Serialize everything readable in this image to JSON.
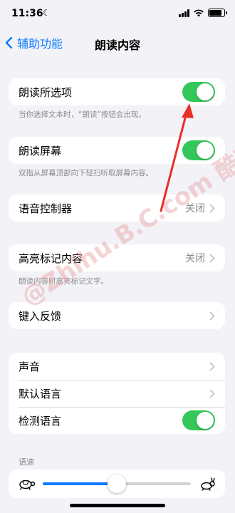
{
  "status": {
    "time": "11:36",
    "battery_level": 0.85
  },
  "nav": {
    "back_label": "辅助功能",
    "title": "朗读内容"
  },
  "groups": {
    "speak_selection": {
      "label": "朗读所选项",
      "toggle": true,
      "footnote": "当你选择文本时，“朗读”按钮会出现。"
    },
    "speak_screen": {
      "label": "朗读屏幕",
      "toggle": true,
      "footnote": "双指从屏幕顶部向下轻扫听取屏幕内容。"
    },
    "speech_controller": {
      "label": "语音控制器",
      "value": "关闭"
    },
    "highlight": {
      "label": "高亮标记内容",
      "value": "关闭",
      "footnote": "朗读内容时高亮标记文字。"
    },
    "typing_feedback": {
      "label": "键入反馈"
    },
    "voices": {
      "label": "声音"
    },
    "default_language": {
      "label": "默认语言"
    },
    "detect_language": {
      "label": "检测语言",
      "toggle": true
    }
  },
  "speaking_rate": {
    "header": "语速",
    "value": 0.5
  },
  "watermark": "@Zhihu.B.C.com 酷壳网",
  "colors": {
    "accent": "#0a7aff",
    "toggle_on": "#34c759",
    "annotation": "#e8302a",
    "background": "#f2f2f7"
  },
  "icons": [
    "moon-icon",
    "signal-icon",
    "wifi-icon",
    "battery-icon",
    "back-chevron-icon",
    "chevron-right-icon",
    "turtle-icon",
    "rabbit-icon"
  ]
}
